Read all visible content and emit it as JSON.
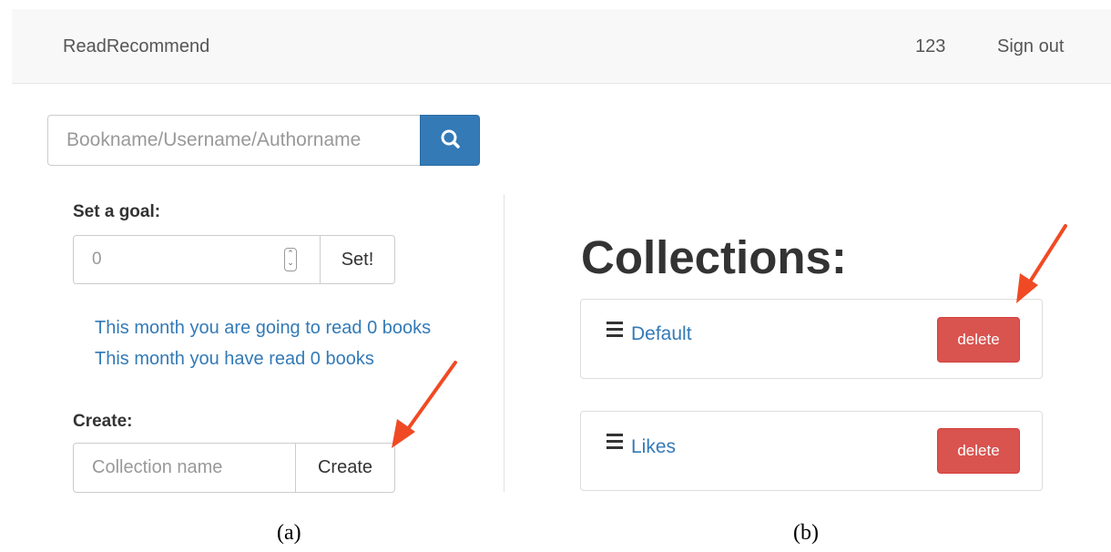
{
  "navbar": {
    "brand": "ReadRecommend",
    "user": "123",
    "signout": "Sign out"
  },
  "search": {
    "placeholder": "Bookname/Username/Authorname",
    "button_icon": "search-icon"
  },
  "goal": {
    "label": "Set a goal:",
    "value": "0",
    "button": "Set!"
  },
  "progress": {
    "going_to_read": "This month you are going to read 0 books",
    "have_read": "This month you have read 0 books"
  },
  "create": {
    "label": "Create:",
    "placeholder": "Collection name",
    "button": "Create"
  },
  "collections": {
    "heading": "Collections:",
    "items": [
      {
        "name": "Default",
        "delete_label": "delete",
        "icon": "list-icon"
      },
      {
        "name": "Likes",
        "delete_label": "delete",
        "icon": "list-icon"
      }
    ]
  },
  "captions": {
    "left": "(a)",
    "right": "(b)"
  },
  "colors": {
    "primary": "#337ab7",
    "danger": "#d9534f",
    "annotation_arrow": "#f04a24"
  }
}
